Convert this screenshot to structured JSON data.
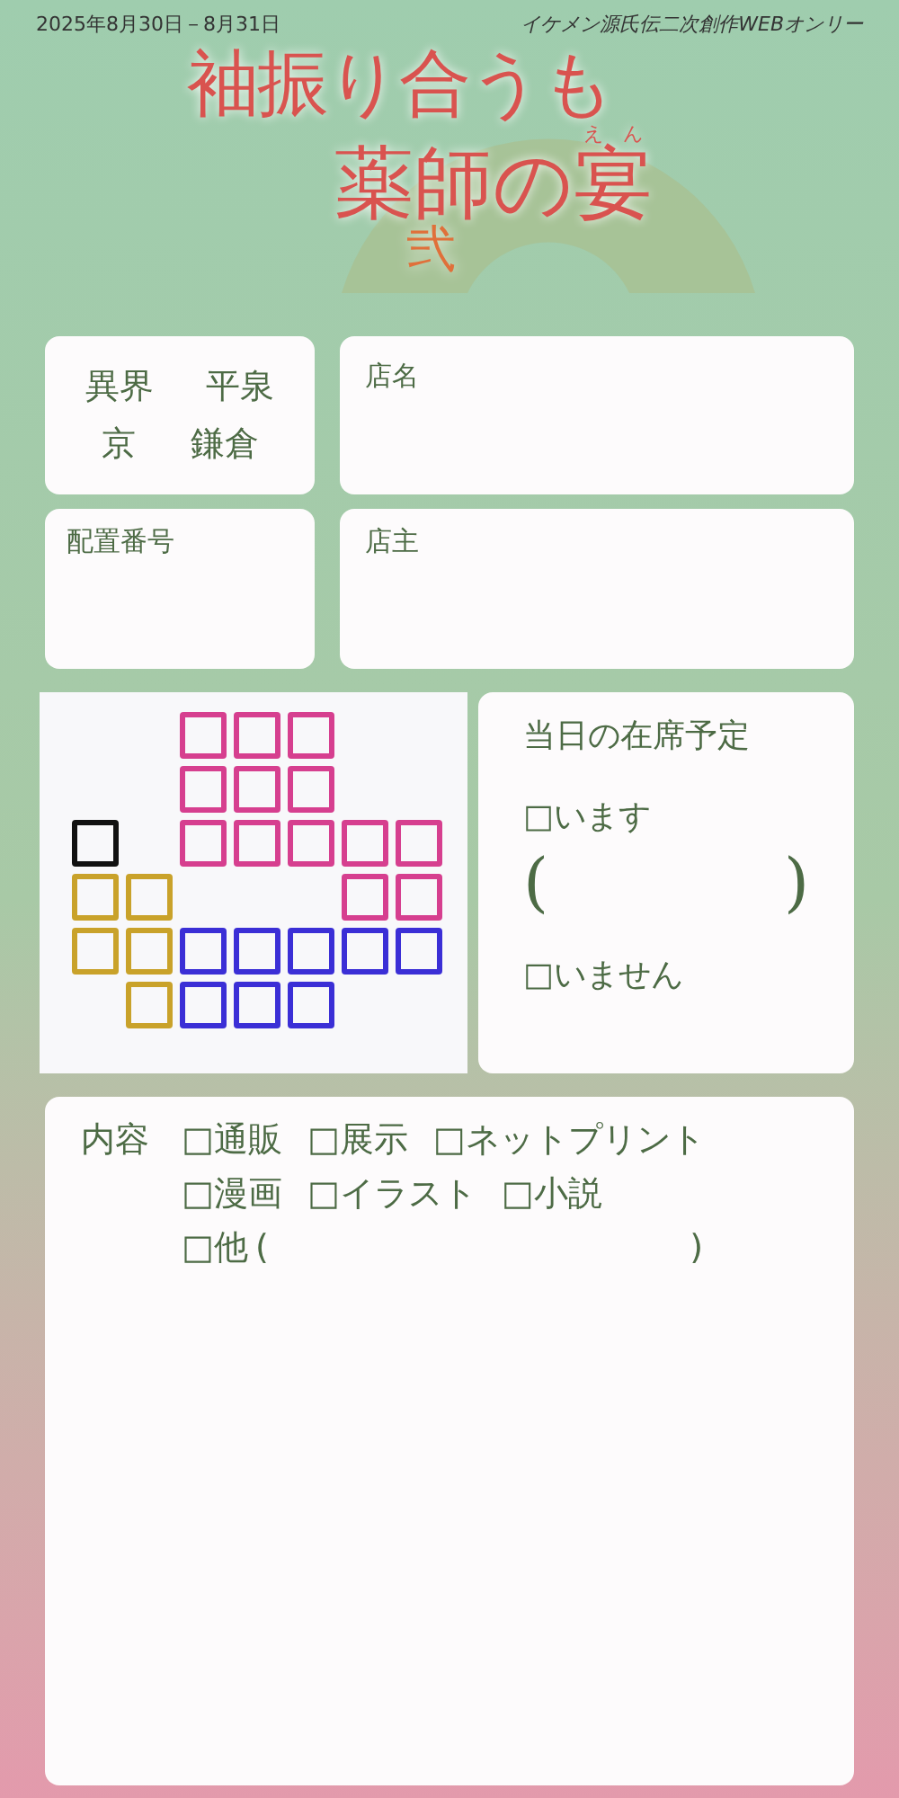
{
  "header": {
    "date": "2025年8月30日－8月31日",
    "event": "イケメン源氏伝二次創作WEBオンリー"
  },
  "title": {
    "line1": "袖振り合うも",
    "line2": "薬師の",
    "last": "宴",
    "ruby": "えん",
    "number": "弐"
  },
  "areas": {
    "row1": [
      "異界",
      "平泉"
    ],
    "row2": [
      "京",
      "鎌倉"
    ]
  },
  "shop_name": {
    "label": "店名"
  },
  "booth_number": {
    "label": "配置番号"
  },
  "owner": {
    "label": "店主"
  },
  "map": {
    "rows": [
      {
        "cells": [
          {
            "kind": "gap"
          },
          {
            "kind": "gap"
          },
          {
            "kind": "booth",
            "color": "#d63f8f"
          },
          {
            "kind": "booth",
            "color": "#d63f8f"
          },
          {
            "kind": "booth",
            "color": "#d63f8f"
          },
          {
            "kind": "gap"
          },
          {
            "kind": "gap"
          }
        ]
      },
      {
        "cells": [
          {
            "kind": "gap"
          },
          {
            "kind": "gap"
          },
          {
            "kind": "booth",
            "color": "#d63f8f"
          },
          {
            "kind": "booth",
            "color": "#d63f8f"
          },
          {
            "kind": "booth",
            "color": "#d63f8f"
          },
          {
            "kind": "gap"
          },
          {
            "kind": "gap"
          }
        ]
      },
      {
        "cells": [
          {
            "kind": "booth",
            "color": "#111111"
          },
          {
            "kind": "gap"
          },
          {
            "kind": "booth",
            "color": "#d63f8f"
          },
          {
            "kind": "booth",
            "color": "#d63f8f"
          },
          {
            "kind": "booth",
            "color": "#d63f8f"
          },
          {
            "kind": "booth",
            "color": "#d63f8f"
          },
          {
            "kind": "booth",
            "color": "#d63f8f"
          }
        ]
      },
      {
        "cells": [
          {
            "kind": "booth",
            "color": "#c9a22a"
          },
          {
            "kind": "booth",
            "color": "#c9a22a"
          },
          {
            "kind": "gap"
          },
          {
            "kind": "gap"
          },
          {
            "kind": "gap"
          },
          {
            "kind": "booth",
            "color": "#d63f8f"
          },
          {
            "kind": "booth",
            "color": "#d63f8f"
          }
        ]
      },
      {
        "cells": [
          {
            "kind": "booth",
            "color": "#c9a22a"
          },
          {
            "kind": "booth",
            "color": "#c9a22a"
          },
          {
            "kind": "booth",
            "color": "#3b2fd6"
          },
          {
            "kind": "booth",
            "color": "#3b2fd6"
          },
          {
            "kind": "booth",
            "color": "#3b2fd6"
          },
          {
            "kind": "booth",
            "color": "#3b2fd6"
          },
          {
            "kind": "booth",
            "color": "#3b2fd6"
          }
        ]
      },
      {
        "cells": [
          {
            "kind": "gap"
          },
          {
            "kind": "booth",
            "color": "#c9a22a"
          },
          {
            "kind": "booth",
            "color": "#3b2fd6"
          },
          {
            "kind": "booth",
            "color": "#3b2fd6"
          },
          {
            "kind": "booth",
            "color": "#3b2fd6"
          },
          {
            "kind": "gap"
          },
          {
            "kind": "gap"
          }
        ]
      }
    ]
  },
  "attendance": {
    "title": "当日の在席予定",
    "present": "□います",
    "open_paren": "(",
    "close_paren": ")",
    "absent": "□いません"
  },
  "contents": {
    "label": "内容",
    "rows": [
      [
        "□通販",
        "□展示",
        "□ネットプリント"
      ],
      [
        "□漫画",
        "□イラスト",
        "□小説"
      ]
    ],
    "other": "□他",
    "other_open": "(",
    "other_close": ")"
  }
}
